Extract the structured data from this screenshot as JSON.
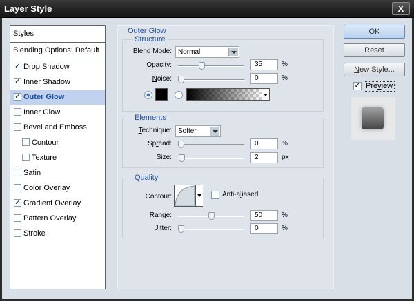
{
  "window": {
    "title": "Layer Style",
    "close_glyph": "X"
  },
  "styles_panel": {
    "header": "Styles",
    "blending": "Blending Options: Default",
    "items": [
      {
        "label": "Drop Shadow",
        "checked": true,
        "indent": false,
        "selected": false
      },
      {
        "label": "Inner Shadow",
        "checked": true,
        "indent": false,
        "selected": false
      },
      {
        "label": "Outer Glow",
        "checked": true,
        "indent": false,
        "selected": true
      },
      {
        "label": "Inner Glow",
        "checked": false,
        "indent": false,
        "selected": false
      },
      {
        "label": "Bevel and Emboss",
        "checked": false,
        "indent": false,
        "selected": false
      },
      {
        "label": "Contour",
        "checked": false,
        "indent": true,
        "selected": false
      },
      {
        "label": "Texture",
        "checked": false,
        "indent": true,
        "selected": false
      },
      {
        "label": "Satin",
        "checked": false,
        "indent": false,
        "selected": false
      },
      {
        "label": "Color Overlay",
        "checked": false,
        "indent": false,
        "selected": false
      },
      {
        "label": "Gradient Overlay",
        "checked": true,
        "indent": false,
        "selected": false
      },
      {
        "label": "Pattern Overlay",
        "checked": false,
        "indent": false,
        "selected": false
      },
      {
        "label": "Stroke",
        "checked": false,
        "indent": false,
        "selected": false
      }
    ]
  },
  "outer_glow": {
    "title": "Outer Glow",
    "structure": {
      "title": "Structure",
      "blend_mode_label": "Blend Mode:",
      "blend_mode_value": "Normal",
      "opacity_label": "Opacity:",
      "opacity_value": "35",
      "opacity_level": 0.35,
      "noise_label": "Noise:",
      "noise_value": "0",
      "noise_level": 0,
      "percent": "%",
      "glow_color": "#000000"
    },
    "elements": {
      "title": "Elements",
      "technique_label": "Technique:",
      "technique_value": "Softer",
      "spread_label": "Spread:",
      "spread_value": "0",
      "spread_level": 0,
      "size_label": "Size:",
      "size_value": "2",
      "size_level": 0.01,
      "percent": "%",
      "px": "px"
    },
    "quality": {
      "title": "Quality",
      "contour_label": "Contour:",
      "anti_aliased_label": "Anti-aliased",
      "anti_aliased_checked": false,
      "range_label": "Range:",
      "range_value": "50",
      "range_level": 0.5,
      "jitter_label": "Jitter:",
      "jitter_value": "0",
      "jitter_level": 0,
      "percent": "%"
    }
  },
  "buttons": {
    "ok": "OK",
    "reset": "Reset",
    "new_style": "New Style...",
    "preview_label": "Preview",
    "preview_checked": true
  },
  "colors": {
    "accent": "#1d4fa0",
    "selected_row": "#c1d2ee",
    "title_bar": "#202020"
  },
  "icons": {
    "radio_selected": "radio-selected-icon",
    "radio_unselected": "radio-unselected-icon",
    "dropdown": "chevron-down-icon",
    "close": "close-icon"
  }
}
